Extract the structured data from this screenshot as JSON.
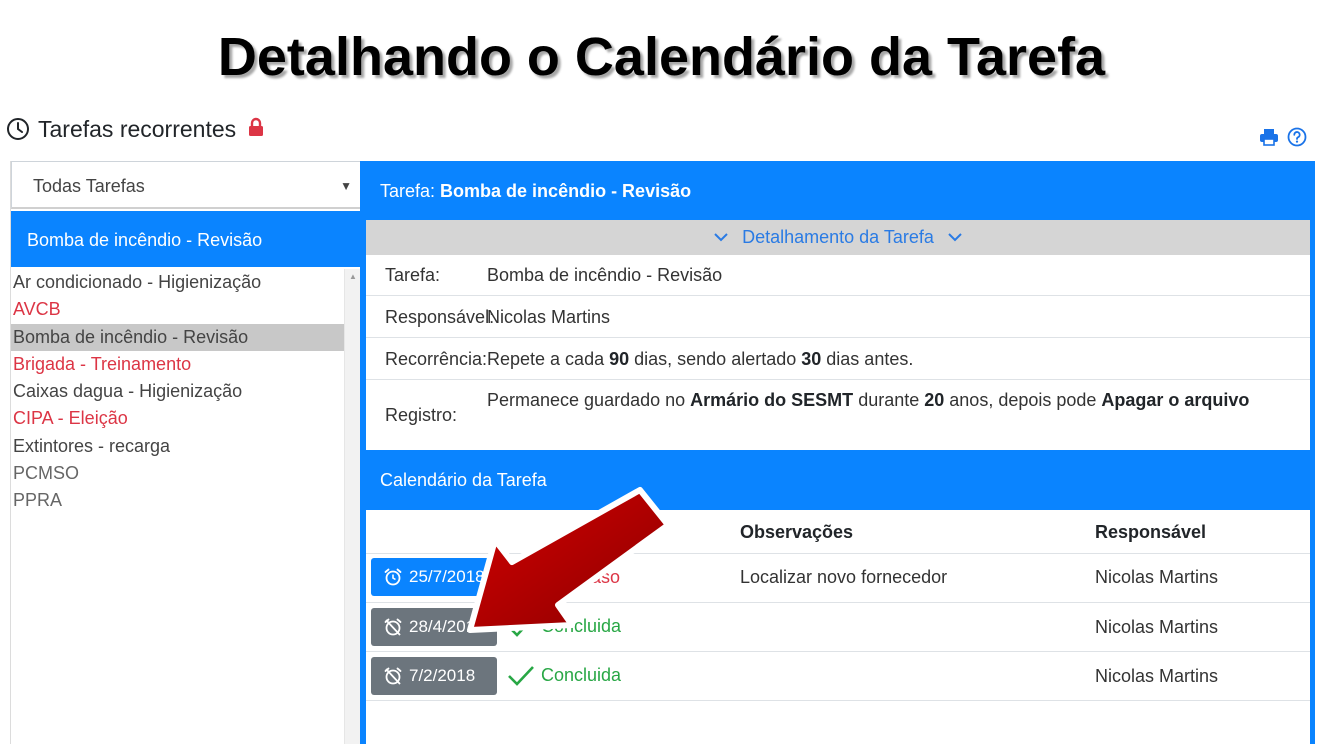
{
  "slide_title": "Detalhando o Calendário da Tarefa",
  "header": {
    "title": "Tarefas recorrentes"
  },
  "filter": {
    "selected": "Todas Tarefas"
  },
  "selected_task": "Bomba de incêndio - Revisão",
  "task_list": [
    {
      "label": "Ar condicionado - Higienização",
      "state": "normal"
    },
    {
      "label": "AVCB",
      "state": "red"
    },
    {
      "label": "Bomba de incêndio - Revisão",
      "state": "selected"
    },
    {
      "label": "Brigada - Treinamento",
      "state": "red"
    },
    {
      "label": "Caixas dagua - Higienização",
      "state": "normal"
    },
    {
      "label": "CIPA - Eleição",
      "state": "red"
    },
    {
      "label": "Extintores - recarga",
      "state": "normal"
    },
    {
      "label": "PCMSO",
      "state": "gray"
    },
    {
      "label": "PPRA",
      "state": "gray"
    }
  ],
  "task_header": {
    "prefix": "Tarefa:",
    "name": "Bomba de incêndio - Revisão"
  },
  "detail": {
    "toggle_label": "Detalhamento da Tarefa",
    "tarefa_key": "Tarefa:",
    "tarefa_val": "Bomba de incêndio - Revisão",
    "resp_key": "Responsável:",
    "resp_val": "Nicolas Martins",
    "rec_key": "Recorrência:",
    "rec_p1": "Repete a cada ",
    "rec_days": "90",
    "rec_p2": " dias, sendo alertado ",
    "rec_alert": "30",
    "rec_p3": " dias antes.",
    "reg_key": "Registro:",
    "reg_p1": "Permanece guardado no ",
    "reg_place": "Armário do SESMT",
    "reg_p2": " durante ",
    "reg_years": "20",
    "reg_p3": " anos, depois pode ",
    "reg_action": "Apagar o arquivo"
  },
  "calendar": {
    "title": "Calendário da Tarefa",
    "col_obs": "Observações",
    "col_resp": "Responsável",
    "rows": [
      {
        "date": "25/7/2018",
        "status": "dias de atraso",
        "obs": "Localizar novo fornecedor",
        "resp": "Nicolas Martins"
      },
      {
        "date": "28/4/2018",
        "status": "Concluida",
        "obs": "",
        "resp": "Nicolas Martins"
      },
      {
        "date": "7/2/2018",
        "status": "Concluida",
        "obs": "",
        "resp": "Nicolas Martins"
      }
    ]
  },
  "colors": {
    "primary": "#0a84ff",
    "danger": "#dc3545",
    "success": "#28a745",
    "secondary": "#6c757d",
    "arrow": "#b00000"
  },
  "icons": {
    "clock": "clock-icon",
    "lock": "lock-icon",
    "print": "print-icon",
    "help": "help-icon",
    "alarm": "alarm-icon",
    "alarm_off": "alarm-off-icon",
    "check": "check-icon"
  }
}
